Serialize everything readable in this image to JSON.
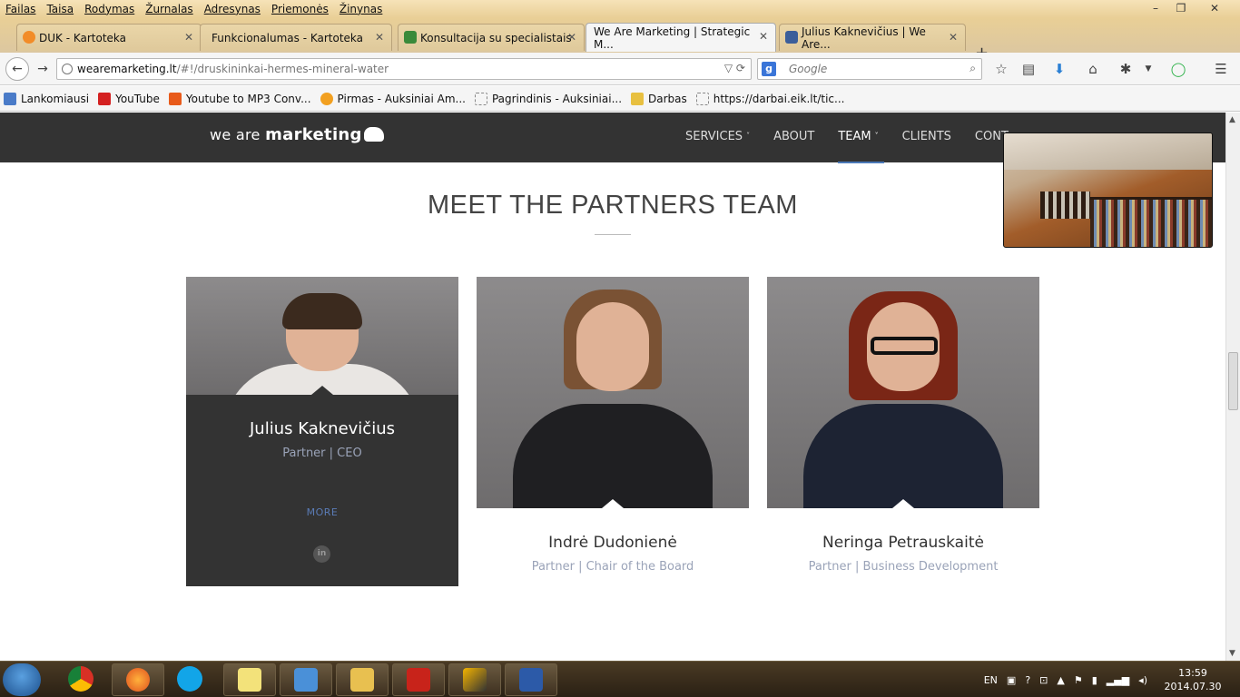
{
  "menu": [
    "Failas",
    "Taisa",
    "Rodymas",
    "Žurnalas",
    "Adresynas",
    "Priemonės",
    "Žinynas"
  ],
  "window_controls": {
    "minimize": "–",
    "maximize": "❐",
    "close": "✕"
  },
  "tabs": [
    {
      "label": "DUK - Kartoteka",
      "color": "#f28c28"
    },
    {
      "label": "Funkcionalumas - Kartoteka",
      "color": ""
    },
    {
      "label": "Konsultacija su specialistais",
      "color": "#3a8a3a"
    },
    {
      "label": "We Are Marketing | Strategic M...",
      "color": ""
    },
    {
      "label": "Julius Kaknevičius | We Are...",
      "color": "#3b5e9a"
    }
  ],
  "new_tab": "+",
  "address": {
    "host": "wearemarketing.lt",
    "path": "/#!/druskininkai-hermes-mineral-water"
  },
  "search": {
    "placeholder": "Google",
    "engine_letter": "g"
  },
  "bookmarks": [
    {
      "label": "Lankomiausi",
      "color": "#4a7bc8"
    },
    {
      "label": "YouTube",
      "color": "#d42121"
    },
    {
      "label": "Youtube to MP3 Conv...",
      "color": "#e85a1a"
    },
    {
      "label": "Pirmas - Auksiniai Am...",
      "color": "#f2a020"
    },
    {
      "label": "Pagrindinis - Auksiniai...",
      "color": ""
    },
    {
      "label": "Darbas",
      "color": "#e8c040"
    },
    {
      "label": "https://darbai.eik.lt/tic...",
      "color": ""
    }
  ],
  "site": {
    "logo_light": "we are ",
    "logo_bold": "marketing",
    "nav": [
      {
        "label": "SERVICES",
        "caret": "˅"
      },
      {
        "label": "ABOUT",
        "caret": ""
      },
      {
        "label": "TEAM",
        "caret": "˅"
      },
      {
        "label": "CLIENTS",
        "caret": ""
      },
      {
        "label": "CONT",
        "caret": ""
      }
    ],
    "section_title": "MEET THE PARTNERS TEAM",
    "team": [
      {
        "name": "Julius Kaknevičius",
        "role": "Partner | CEO",
        "more": "MORE",
        "social": "in"
      },
      {
        "name": "Indrė Dudonienė",
        "role": "Partner | Chair of the Board"
      },
      {
        "name": "Neringa Petrauskaitė",
        "role": "Partner | Business Development"
      }
    ]
  },
  "taskbar": {
    "lang": "EN",
    "time": "13:59",
    "date": "2014.07.30"
  }
}
